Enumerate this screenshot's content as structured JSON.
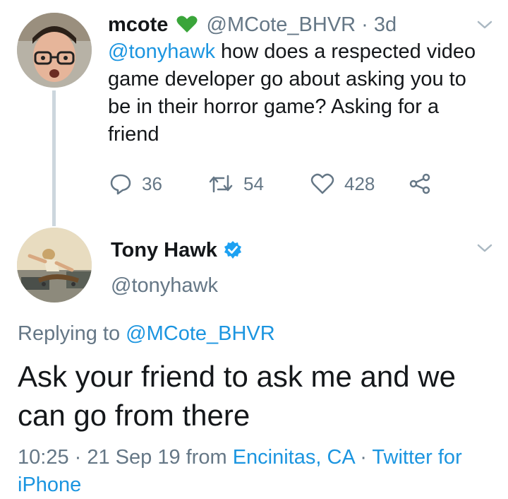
{
  "tweet1": {
    "name": "mcote",
    "badge_icon": "green-heart-icon",
    "handle": "@MCote_BHVR",
    "age": "· 3d",
    "mention": "@tonyhawk",
    "text": " how does a respected video game developer go about asking you to be in their horror game?  Asking for a friend",
    "replies": "36",
    "retweets": "54",
    "likes": "428"
  },
  "tweet2": {
    "name": "Tony Hawk",
    "verified_icon": "verified-badge-icon",
    "handle": "@tonyhawk",
    "replying_prefix": "Replying to ",
    "replying_to": "@MCote_BHVR",
    "text": "Ask your friend to ask me and we can go from there",
    "time": "10:25 · 21 Sep 19 from ",
    "location": "Encinitas, CA",
    "separator": " · ",
    "client": "Twitter for iPhone"
  },
  "colors": {
    "link": "#1b95e0",
    "muted": "#657786",
    "heart_green": "#3aa53a",
    "thread_line": "#ccd6dd"
  }
}
